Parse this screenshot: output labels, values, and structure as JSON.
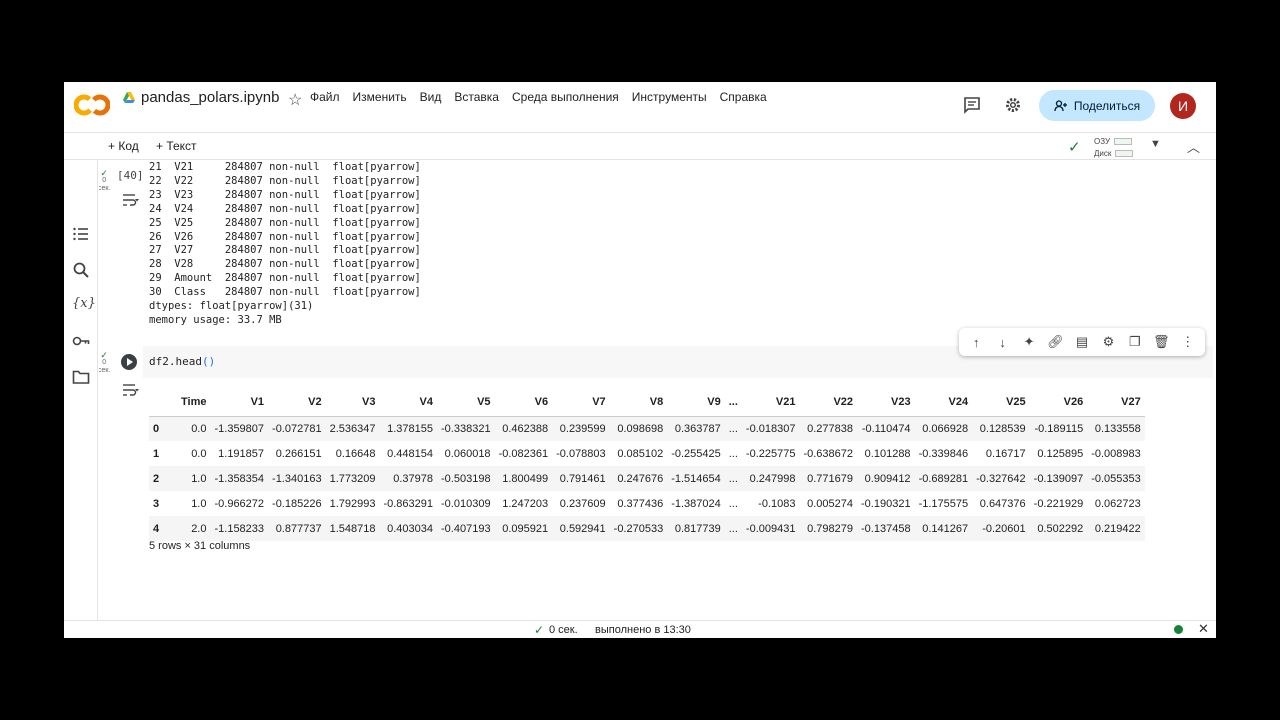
{
  "header": {
    "title": "pandas_polars.ipynb",
    "menu": [
      "Файл",
      "Изменить",
      "Вид",
      "Вставка",
      "Среда выполнения",
      "Инструменты",
      "Справка"
    ],
    "share_label": "Поделиться",
    "avatar_letter": "И"
  },
  "toolbar": {
    "add_code": "+ Код",
    "add_text": "+ Текст",
    "ram_label": "ОЗУ",
    "disk_label": "Диск"
  },
  "cell1": {
    "exec_count": "[40]",
    "exec_time_value": "0",
    "exec_time_unit": "сек.",
    "output": "21  V21     284807 non-null  float[pyarrow]\n22  V22     284807 non-null  float[pyarrow]\n23  V23     284807 non-null  float[pyarrow]\n24  V24     284807 non-null  float[pyarrow]\n25  V25     284807 non-null  float[pyarrow]\n26  V26     284807 non-null  float[pyarrow]\n27  V27     284807 non-null  float[pyarrow]\n28  V28     284807 non-null  float[pyarrow]\n29  Amount  284807 non-null  float[pyarrow]\n30  Class   284807 non-null  float[pyarrow]\ndtypes: float[pyarrow](31)\nmemory usage: 33.7 MB"
  },
  "cell2": {
    "exec_time_value": "0",
    "exec_time_unit": "сек.",
    "code_var": "df2",
    "code_method": ".head",
    "code_parens": "()",
    "table": {
      "columns": [
        "",
        "Time",
        "V1",
        "V2",
        "V3",
        "V4",
        "V5",
        "V6",
        "V7",
        "V8",
        "V9",
        "...",
        "V21",
        "V22",
        "V23",
        "V24",
        "V25",
        "V26",
        "V27"
      ],
      "rows": [
        [
          "0",
          "0.0",
          "-1.359807",
          "-0.072781",
          "2.536347",
          "1.378155",
          "-0.338321",
          "0.462388",
          "0.239599",
          "0.098698",
          "0.363787",
          "...",
          "-0.018307",
          "0.277838",
          "-0.110474",
          "0.066928",
          "0.128539",
          "-0.189115",
          "0.133558"
        ],
        [
          "1",
          "0.0",
          "1.191857",
          "0.266151",
          "0.16648",
          "0.448154",
          "0.060018",
          "-0.082361",
          "-0.078803",
          "0.085102",
          "-0.255425",
          "...",
          "-0.225775",
          "-0.638672",
          "0.101288",
          "-0.339846",
          "0.16717",
          "0.125895",
          "-0.008983"
        ],
        [
          "2",
          "1.0",
          "-1.358354",
          "-1.340163",
          "1.773209",
          "0.37978",
          "-0.503198",
          "1.800499",
          "0.791461",
          "0.247676",
          "-1.514654",
          "...",
          "0.247998",
          "0.771679",
          "0.909412",
          "-0.689281",
          "-0.327642",
          "-0.139097",
          "-0.055353"
        ],
        [
          "3",
          "1.0",
          "-0.966272",
          "-0.185226",
          "1.792993",
          "-0.863291",
          "-0.010309",
          "1.247203",
          "0.237609",
          "0.377436",
          "-1.387024",
          "...",
          "-0.1083",
          "0.005274",
          "-0.190321",
          "-1.175575",
          "0.647376",
          "-0.221929",
          "0.062723"
        ],
        [
          "4",
          "2.0",
          "-1.158233",
          "0.877737",
          "1.548718",
          "0.403034",
          "-0.407193",
          "0.095921",
          "0.592941",
          "-0.270533",
          "0.817739",
          "...",
          "-0.009431",
          "0.798279",
          "-0.137458",
          "0.141267",
          "-0.20601",
          "0.502292",
          "0.219422"
        ]
      ]
    },
    "shape_text": "5 rows × 31 columns"
  },
  "status": {
    "time": "0 сек.",
    "done": "выполнено в 13:30"
  }
}
